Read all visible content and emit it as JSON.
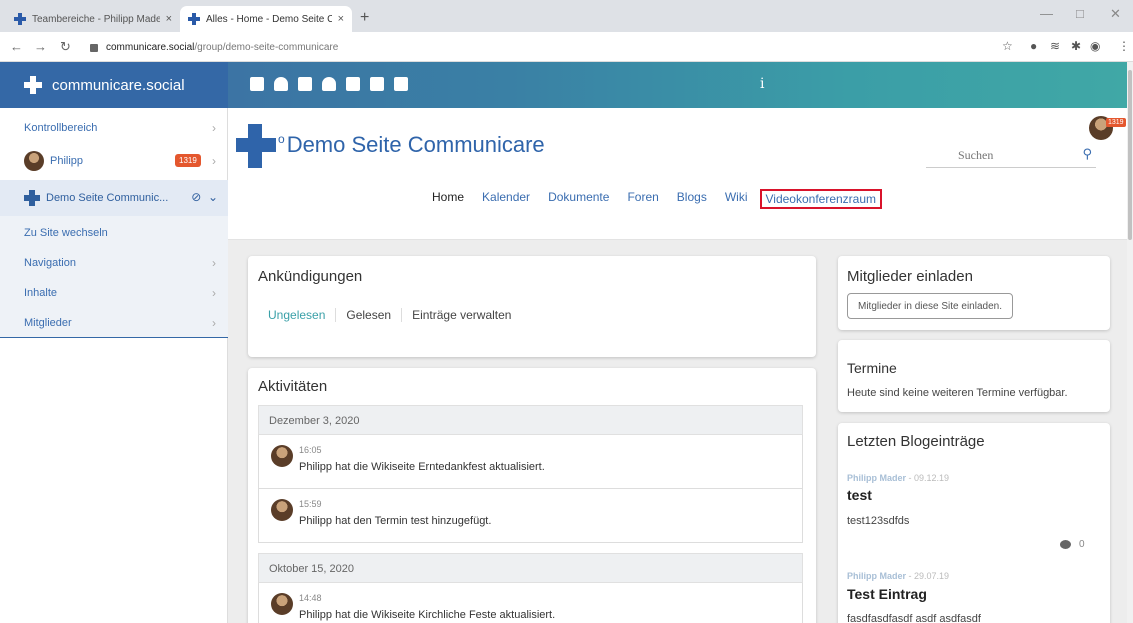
{
  "browser": {
    "tabs": [
      {
        "title": "Teambereiche - Philipp Mader - c"
      },
      {
        "title": "Alles - Home - Demo Seite Comm"
      }
    ],
    "new_tab": "+",
    "close_glyph": "×",
    "url_host": "communicare.social",
    "url_path": "/group/demo-seite-communicare"
  },
  "app": {
    "brand": "communicare.social",
    "info_glyph": "i"
  },
  "sidebar": {
    "kontroll": "Kontrollbereich",
    "user": "Philipp",
    "badge": "1319",
    "site": "Demo Seite Communic...",
    "switch": "Zu Site wechseln",
    "sub": [
      "Navigation",
      "Inhalte",
      "Mitglieder"
    ]
  },
  "site": {
    "title": "Demo Seite Communicare",
    "search_placeholder": "Suchen",
    "badge": "1319",
    "nav": [
      "Home",
      "Kalender",
      "Dokumente",
      "Foren",
      "Blogs",
      "Wiki",
      "Videokonferenzraum"
    ]
  },
  "announcements": {
    "title": "Ankündigungen",
    "tabs": [
      "Ungelesen",
      "Gelesen",
      "Einträge verwalten"
    ]
  },
  "activities": {
    "title": "Aktivitäten",
    "groups": [
      {
        "date": "Dezember 3, 2020",
        "items": [
          {
            "time": "16:05",
            "text": "Philipp hat die Wikiseite Erntedankfest aktualisiert."
          },
          {
            "time": "15:59",
            "text": "Philipp hat den Termin test hinzugefügt."
          }
        ]
      },
      {
        "date": "Oktober 15, 2020",
        "items": [
          {
            "time": "14:48",
            "text": "Philipp hat die Wikiseite Kirchliche Feste aktualisiert."
          }
        ]
      }
    ]
  },
  "invite": {
    "title": "Mitglieder einladen",
    "button": "Mitglieder in diese Site einladen."
  },
  "events": {
    "title": "Termine",
    "text": "Heute sind keine weiteren Termine verfügbar."
  },
  "blogs": {
    "title": "Letzten Blogeinträge",
    "entries": [
      {
        "author": "Philipp Mader",
        "date": " - 09.12.19",
        "title": "test",
        "text": "test123sdfds",
        "comments": "0"
      },
      {
        "author": "Philipp Mader",
        "date": " - 29.07.19",
        "title": "Test Eintrag",
        "text": "fasdfasdfasdf asdf asdfasdf"
      }
    ]
  },
  "colors": {
    "accent": "#3468a6",
    "teal": "#3aa0a8",
    "highlight": "#d9132b",
    "badge": "#e4572e"
  }
}
